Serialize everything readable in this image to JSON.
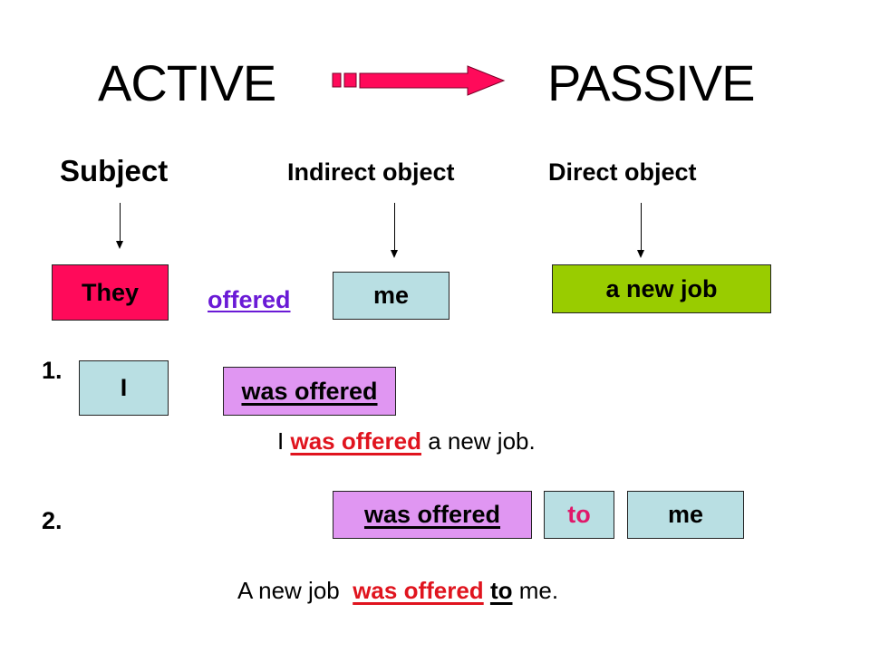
{
  "title": {
    "left": "ACTIVE",
    "right": "PASSIVE",
    "arrow_icon": "right-arrow-icon",
    "arrow_color": "#ff0a5a"
  },
  "headers": {
    "subject": "Subject",
    "indirect": "Indirect object",
    "direct": "Direct object"
  },
  "active_sentence": {
    "subject": "They",
    "verb": "offered",
    "indirect_object": "me",
    "direct_object": "a new job"
  },
  "variant1": {
    "number": "1.",
    "subject_box": "I",
    "verb_box": "was offered",
    "sentence": {
      "subject": "I",
      "verb": "was offered",
      "rest": "a new job."
    }
  },
  "variant2": {
    "number": "2.",
    "verb_box": "was offered",
    "prep_box": "to",
    "object_box": "me",
    "sentence": {
      "subject": "A new job",
      "verb": "was offered",
      "prep": "to",
      "rest": "me."
    }
  },
  "colors": {
    "subject_box": "#ff0a5a",
    "object_box": "#b9dfe3",
    "direct_object_box": "#99cc00",
    "verb_box": "#e096f2",
    "verb_link": "#6a1ad6",
    "highlight_red": "#e0141e",
    "preposition": "#e0186a"
  }
}
